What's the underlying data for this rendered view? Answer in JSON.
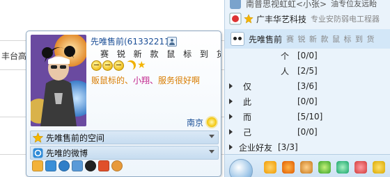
{
  "background_page": {
    "partial_text": "丰台高"
  },
  "buddy_list": {
    "top_partial": {
      "name": "南普思视虹虹<小张>",
      "signature": "油专位友远眙"
    },
    "contacts": [
      {
        "name": "广丰华艺科技",
        "signature": "专业安防弱电工程器"
      },
      {
        "name": "先唯售前",
        "signature": "赛 锐 新 款 鼠 标 到 货",
        "selected": true
      }
    ],
    "groups": [
      {
        "name": "个",
        "count": "[0/0]"
      },
      {
        "name": "人",
        "count": "[2/5]"
      },
      {
        "name": "仅",
        "count": "[3/6]"
      },
      {
        "name": "此",
        "count": "[0/0]"
      },
      {
        "name": "而",
        "count": "[5/10]"
      },
      {
        "name": "己",
        "count": "[0/0]"
      },
      {
        "name": "企业好友",
        "count": "[3/3]"
      }
    ],
    "bottom_icons": [
      "check-shield-icon",
      "penguin-icon",
      "pet-icon",
      "swirl-icon",
      "play-icon",
      "browser-icon",
      "shield-icon"
    ]
  },
  "profile_card": {
    "nickname": "先唯售前(61332211)",
    "slogan": "赛 锐 新 款 鼠 标 到 货",
    "signature_parts": [
      {
        "text": "贩鼠标的、",
        "color": "#d87c00"
      },
      {
        "text": "小翔、",
        "color": "#c0208a"
      },
      {
        "text": "服务很好啊",
        "color": "#d87c00"
      }
    ],
    "city": "南京",
    "links": [
      {
        "label": "先唯售前的空间"
      },
      {
        "label": "先唯的微博"
      }
    ],
    "toolbar_icons": [
      "qzone-icon",
      "qq-mail-icon",
      "pai-icon",
      "phone-icon",
      "penguin-icon",
      "home-icon",
      "pet-icon"
    ]
  },
  "colors": {
    "link_blue": "#1a4e96",
    "panel_bg": "#eaf3fb",
    "selected_bg": "#d3e7f8"
  }
}
